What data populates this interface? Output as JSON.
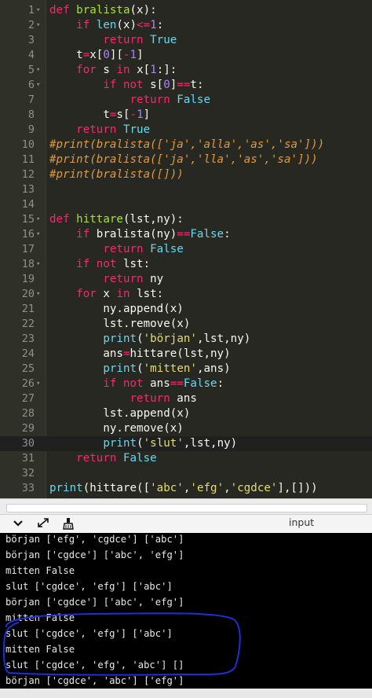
{
  "editor": {
    "lines": [
      {
        "num": "1",
        "fold": true,
        "segments": [
          [
            "k",
            "def "
          ],
          [
            "f",
            "bralista"
          ],
          [
            "",
            "(x):"
          ]
        ]
      },
      {
        "num": "2",
        "fold": true,
        "segments": [
          [
            "",
            "    "
          ],
          [
            "k",
            "if "
          ],
          [
            "b",
            "len"
          ],
          [
            "",
            "(x)"
          ],
          [
            "o",
            "<="
          ],
          [
            "n",
            "1"
          ],
          [
            "",
            ":"
          ]
        ]
      },
      {
        "num": "3",
        "segments": [
          [
            "",
            "        "
          ],
          [
            "k",
            "return "
          ],
          [
            "b",
            "True"
          ]
        ]
      },
      {
        "num": "4",
        "segments": [
          [
            "",
            "    t"
          ],
          [
            "o",
            "="
          ],
          [
            "",
            "x["
          ],
          [
            "n",
            "0"
          ],
          [
            "",
            "]["
          ],
          [
            "o",
            "-"
          ],
          [
            "n",
            "1"
          ],
          [
            "",
            "]"
          ]
        ]
      },
      {
        "num": "5",
        "fold": true,
        "segments": [
          [
            "",
            "    "
          ],
          [
            "k",
            "for "
          ],
          [
            "",
            "s "
          ],
          [
            "k",
            "in "
          ],
          [
            "",
            "x["
          ],
          [
            "n",
            "1"
          ],
          [
            "",
            ":]:"
          ]
        ]
      },
      {
        "num": "6",
        "fold": true,
        "segments": [
          [
            "",
            "        "
          ],
          [
            "k",
            "if not "
          ],
          [
            "",
            "s["
          ],
          [
            "n",
            "0"
          ],
          [
            "",
            "]"
          ],
          [
            "o",
            "=="
          ],
          [
            "",
            "t:"
          ]
        ]
      },
      {
        "num": "7",
        "segments": [
          [
            "",
            "            "
          ],
          [
            "k",
            "return "
          ],
          [
            "b",
            "False"
          ]
        ]
      },
      {
        "num": "8",
        "segments": [
          [
            "",
            "        t"
          ],
          [
            "o",
            "="
          ],
          [
            "",
            "s["
          ],
          [
            "o",
            "-"
          ],
          [
            "n",
            "1"
          ],
          [
            "",
            "]"
          ]
        ]
      },
      {
        "num": "9",
        "segments": [
          [
            "",
            "    "
          ],
          [
            "k",
            "return "
          ],
          [
            "b",
            "True"
          ]
        ]
      },
      {
        "num": "10",
        "segments": [
          [
            "c",
            "#print(bralista(['ja','alla','as','sa']))"
          ]
        ]
      },
      {
        "num": "11",
        "segments": [
          [
            "c",
            "#print(bralista(['ja','lla','as','sa']))"
          ]
        ]
      },
      {
        "num": "12",
        "segments": [
          [
            "c",
            "#print(bralista([]))"
          ]
        ]
      },
      {
        "num": "13",
        "segments": []
      },
      {
        "num": "14",
        "segments": []
      },
      {
        "num": "15",
        "fold": true,
        "segments": [
          [
            "k",
            "def "
          ],
          [
            "f",
            "hittare"
          ],
          [
            "",
            "(lst,ny):"
          ]
        ]
      },
      {
        "num": "16",
        "fold": true,
        "segments": [
          [
            "",
            "    "
          ],
          [
            "k",
            "if "
          ],
          [
            "",
            "bralista(ny)"
          ],
          [
            "o",
            "=="
          ],
          [
            "b",
            "False"
          ],
          [
            "",
            ":"
          ]
        ]
      },
      {
        "num": "17",
        "segments": [
          [
            "",
            "        "
          ],
          [
            "k",
            "return "
          ],
          [
            "b",
            "False"
          ]
        ]
      },
      {
        "num": "18",
        "fold": true,
        "segments": [
          [
            "",
            "    "
          ],
          [
            "k",
            "if not "
          ],
          [
            "",
            "lst:"
          ]
        ]
      },
      {
        "num": "19",
        "segments": [
          [
            "",
            "        "
          ],
          [
            "k",
            "return "
          ],
          [
            "",
            "ny"
          ]
        ]
      },
      {
        "num": "20",
        "fold": true,
        "segments": [
          [
            "",
            "    "
          ],
          [
            "k",
            "for "
          ],
          [
            "",
            "x "
          ],
          [
            "k",
            "in "
          ],
          [
            "",
            "lst:"
          ]
        ]
      },
      {
        "num": "21",
        "segments": [
          [
            "",
            "        ny.append(x)"
          ]
        ]
      },
      {
        "num": "22",
        "segments": [
          [
            "",
            "        lst.remove(x)"
          ]
        ]
      },
      {
        "num": "23",
        "segments": [
          [
            "",
            "        "
          ],
          [
            "b",
            "print"
          ],
          [
            "",
            "("
          ],
          [
            "s",
            "'början'"
          ],
          [
            "",
            ",lst,ny)"
          ]
        ]
      },
      {
        "num": "24",
        "segments": [
          [
            "",
            "        ans"
          ],
          [
            "o",
            "="
          ],
          [
            "",
            "hittare(lst,ny)"
          ]
        ]
      },
      {
        "num": "25",
        "segments": [
          [
            "",
            "        "
          ],
          [
            "b",
            "print"
          ],
          [
            "",
            "("
          ],
          [
            "s",
            "'mitten'"
          ],
          [
            "",
            ",ans)"
          ]
        ]
      },
      {
        "num": "26",
        "fold": true,
        "segments": [
          [
            "",
            "        "
          ],
          [
            "k",
            "if not "
          ],
          [
            "",
            "ans"
          ],
          [
            "o",
            "=="
          ],
          [
            "b",
            "False"
          ],
          [
            "",
            ":"
          ]
        ]
      },
      {
        "num": "27",
        "segments": [
          [
            "",
            "            "
          ],
          [
            "k",
            "return "
          ],
          [
            "",
            "ans"
          ]
        ]
      },
      {
        "num": "28",
        "segments": [
          [
            "",
            "        lst.append(x)"
          ]
        ]
      },
      {
        "num": "29",
        "segments": [
          [
            "",
            "        ny.remove(x)"
          ]
        ]
      },
      {
        "num": "30",
        "active": true,
        "segments": [
          [
            "",
            "        "
          ],
          [
            "b",
            "print"
          ],
          [
            "",
            "("
          ],
          [
            "s",
            "'slut'"
          ],
          [
            "",
            ",lst,ny)"
          ]
        ]
      },
      {
        "num": "31",
        "segments": [
          [
            "",
            "    "
          ],
          [
            "k",
            "return "
          ],
          [
            "b",
            "False"
          ]
        ]
      },
      {
        "num": "32",
        "segments": []
      },
      {
        "num": "33",
        "segments": [
          [
            "b",
            "print"
          ],
          [
            "",
            "(hittare(["
          ],
          [
            "s",
            "'abc'"
          ],
          [
            "",
            ","
          ],
          [
            "s",
            "'efg'"
          ],
          [
            "",
            ","
          ],
          [
            "s",
            "'cgdce'"
          ],
          [
            "",
            "],[]))"
          ]
        ]
      }
    ]
  },
  "toolbar": {
    "collapse_icon": "chevron-down-icon",
    "expand_icon": "expand-arrows-icon",
    "clear_icon": "broom-icon",
    "input_label": "input"
  },
  "console": {
    "output": [
      "början ['efg', 'cgdce'] ['abc']",
      "början ['cgdce'] ['abc', 'efg']",
      "mitten False",
      "slut ['cgdce', 'efg'] ['abc']",
      "början ['cgdce'] ['abc', 'efg']",
      "mitten False",
      "slut ['cgdce', 'efg'] ['abc']",
      "mitten False",
      "slut ['cgdce', 'efg', 'abc'] []",
      "början ['cgdce', 'abc'] ['efg']"
    ]
  },
  "colors": {
    "editor_bg": "#272822",
    "annotation_stroke": "#1d2fd6"
  }
}
